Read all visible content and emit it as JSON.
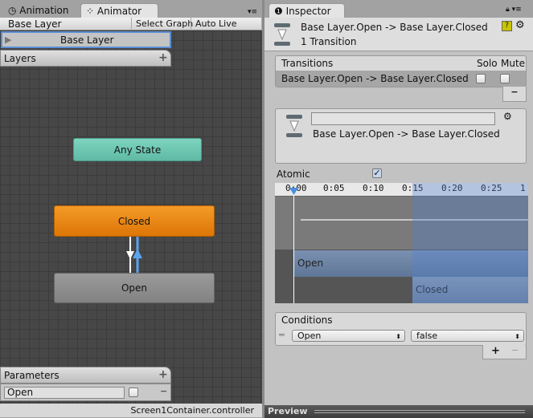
{
  "left_tabs": [
    {
      "label": "Animation",
      "icon": "clock-icon"
    },
    {
      "label": "Animator",
      "icon": "animator-icon"
    }
  ],
  "toolbar": {
    "breadcrumb": "Base Layer",
    "select_graph": "Select Graph",
    "auto_live_link": "Auto Live Link"
  },
  "layers": {
    "current": "Base Layer",
    "header": "Layers",
    "add": "+"
  },
  "nodes": {
    "any_state": "Any State",
    "closed": "Closed",
    "open": "Open"
  },
  "node_colors": {
    "any_state": "#6cc7b2",
    "closed": "#e8820c",
    "open": "#8c8c8c"
  },
  "parameters": {
    "header": "Parameters",
    "add": "+",
    "items": [
      {
        "name": "Open",
        "value": false
      }
    ],
    "remove": "−"
  },
  "status": "Screen1Container.controller",
  "inspector": {
    "tab": "Inspector",
    "title": "Base Layer.Open -> Base Layer.Closed",
    "subtitle": "1 Transition",
    "transitions": {
      "header": "Transitions",
      "solo": "Solo",
      "mute": "Mute",
      "rows": [
        {
          "name": "Base Layer.Open -> Base Layer.Closed",
          "solo": false,
          "mute": false
        }
      ],
      "remove": "−"
    },
    "transition": {
      "name_value": "",
      "label": "Base Layer.Open -> Base Layer.Closed"
    },
    "atomic": {
      "label": "Atomic",
      "checked": true
    },
    "timeline": {
      "ticks": [
        "0:00",
        "0:05",
        "0:10",
        "0:15",
        "0:20",
        "0:25",
        "1"
      ],
      "from": "Open",
      "to": "Closed"
    },
    "conditions": {
      "header": "Conditions",
      "rows": [
        {
          "param": "Open",
          "value": "false"
        }
      ],
      "add": "+",
      "remove": "−"
    },
    "preview": "Preview"
  }
}
